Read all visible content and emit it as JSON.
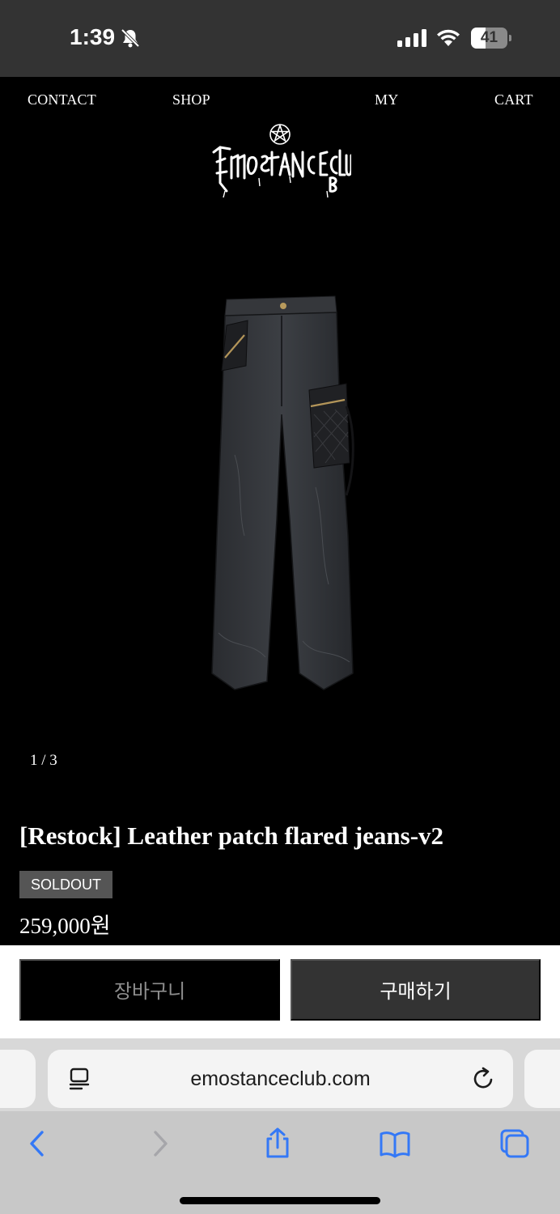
{
  "status_bar": {
    "time": "1:39",
    "battery": "41",
    "battery_fraction": 0.41,
    "icons": [
      "bell-slash-icon",
      "signal-icon",
      "wifi-icon",
      "battery-icon"
    ]
  },
  "nav": {
    "contact": "CONTACT",
    "shop": "SHOP",
    "my": "MY",
    "cart": "CART"
  },
  "logo": {
    "icon": "emostanceclub-logo"
  },
  "gallery": {
    "counter": "1 / 3"
  },
  "product": {
    "title": "[Restock] Leather patch flared jeans-v2",
    "badge": "SOLDOUT",
    "price": "259,000원"
  },
  "actions": {
    "cart_label": "장바구니",
    "buy_label": "구매하기"
  },
  "browser": {
    "url": "emostanceclub.com",
    "toolbar_icons": [
      "back-icon",
      "forward-icon",
      "share-icon",
      "bookmarks-icon",
      "tabs-icon"
    ]
  },
  "colors": {
    "background": "#000000",
    "status_bar": "#333333",
    "badge": "#555555",
    "buy_button": "#333333",
    "ios_blue": "#3478f6"
  }
}
